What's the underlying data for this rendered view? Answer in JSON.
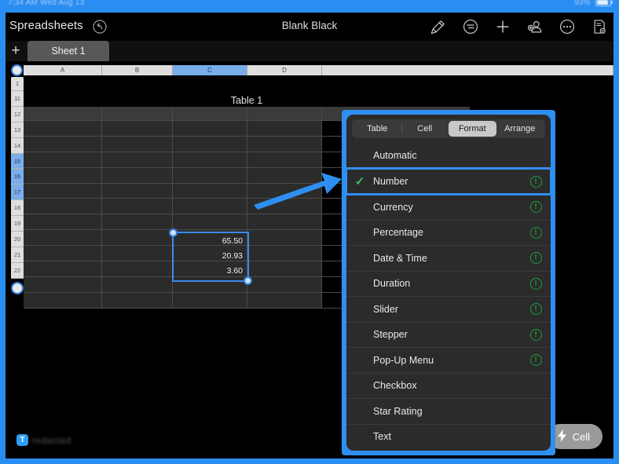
{
  "statusbar": {
    "left_text": "7:34 AM  Wed Aug 13",
    "right_text": "93%"
  },
  "navbar": {
    "back_label": "Spreadsheets",
    "undo_icon": "undo-icon",
    "document_title": "Blank Black",
    "icons": [
      {
        "name": "format-brush-icon",
        "glyph": "brush"
      },
      {
        "name": "insert-object-icon",
        "glyph": "list-circle"
      },
      {
        "name": "add-icon",
        "glyph": "plus"
      },
      {
        "name": "collaborate-icon",
        "glyph": "person-add"
      },
      {
        "name": "more-options-icon",
        "glyph": "ellipsis-circle"
      },
      {
        "name": "document-options-icon",
        "glyph": "doc"
      }
    ]
  },
  "sheetbar": {
    "add_sheet_label": "+",
    "tabs": [
      {
        "label": "Sheet 1",
        "active": true
      }
    ]
  },
  "spreadsheet": {
    "table_title": "Table 1",
    "column_headers": [
      {
        "label": "A",
        "selected": false
      },
      {
        "label": "B",
        "selected": false
      },
      {
        "label": "C",
        "selected": true
      },
      {
        "label": "D",
        "selected": false
      }
    ],
    "row_headers": [
      {
        "label": "1",
        "selected": false
      },
      {
        "label": "11",
        "selected": false
      },
      {
        "label": "12",
        "selected": false
      },
      {
        "label": "13",
        "selected": false
      },
      {
        "label": "14",
        "selected": false
      },
      {
        "label": "15",
        "selected": true
      },
      {
        "label": "16",
        "selected": true
      },
      {
        "label": "17",
        "selected": true
      },
      {
        "label": "18",
        "selected": false
      },
      {
        "label": "19",
        "selected": false
      },
      {
        "label": "20",
        "selected": false
      },
      {
        "label": "21",
        "selected": false
      },
      {
        "label": "22",
        "selected": false
      }
    ],
    "selected_cell_values": [
      "65.50",
      "20.93",
      "3.60"
    ]
  },
  "popover": {
    "tabs": [
      {
        "label": "Table",
        "active": false
      },
      {
        "label": "Cell",
        "active": false
      },
      {
        "label": "Format",
        "active": true
      },
      {
        "label": "Arrange",
        "active": false
      }
    ],
    "items": [
      {
        "label": "Automatic",
        "checked": false,
        "info": false
      },
      {
        "label": "Number",
        "checked": true,
        "info": true,
        "highlighted": true
      },
      {
        "label": "Currency",
        "checked": false,
        "info": true
      },
      {
        "label": "Percentage",
        "checked": false,
        "info": true
      },
      {
        "label": "Date & Time",
        "checked": false,
        "info": true
      },
      {
        "label": "Duration",
        "checked": false,
        "info": true
      },
      {
        "label": "Slider",
        "checked": false,
        "info": true
      },
      {
        "label": "Stepper",
        "checked": false,
        "info": true
      },
      {
        "label": "Pop-Up Menu",
        "checked": false,
        "info": true
      },
      {
        "label": "Checkbox",
        "checked": false,
        "info": false
      },
      {
        "label": "Star Rating",
        "checked": false,
        "info": false
      },
      {
        "label": "Text",
        "checked": false,
        "info": false
      }
    ],
    "check_glyph": "✓",
    "info_glyph": "!"
  },
  "watermark": {
    "badge": "T",
    "text": "redacted"
  },
  "bottom_bar": {
    "cell_button_label": "Cell",
    "cell_button_icon": "lightning-bolt-icon"
  },
  "colors": {
    "frame_blue": "#2a8df2",
    "highlight_blue": "#2f8ff0",
    "check_green": "#39c15a",
    "info_green": "#1f9c3c",
    "app_background": "#000000",
    "popover_background": "#2b2b2b"
  }
}
